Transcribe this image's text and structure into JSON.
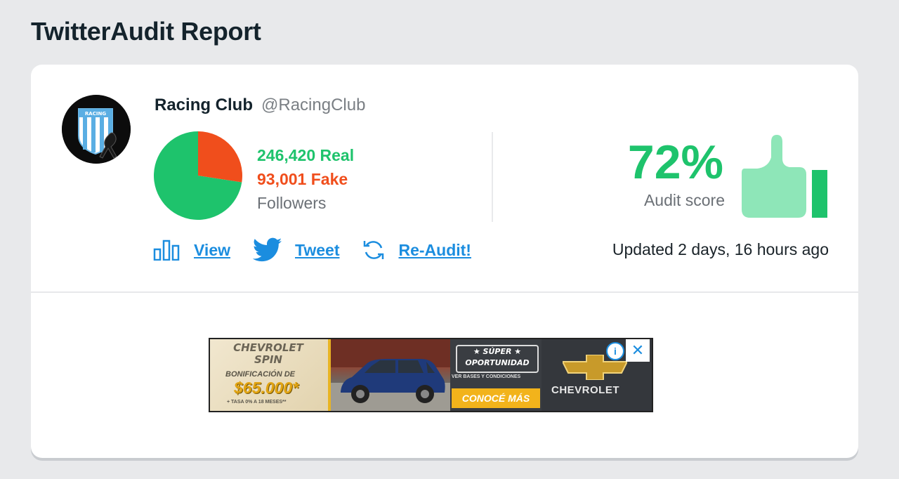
{
  "page": {
    "title": "TwitterAudit Report"
  },
  "account": {
    "name": "Racing Club",
    "handle": "@RacingClub",
    "avatar_text": "RACING"
  },
  "followers": {
    "real_label": "246,420 Real",
    "fake_label": "93,001 Fake",
    "caption": "Followers",
    "real": 246420,
    "fake": 93001
  },
  "score": {
    "value": "72%",
    "label": "Audit score",
    "fraction": 0.72
  },
  "actions": {
    "view": "View",
    "tweet": "Tweet",
    "reaudit": "Re-Audit!"
  },
  "updated": "Updated 2 days, 16 hours ago",
  "ad": {
    "brand_line1": "CHEVROLET",
    "brand_line2": "SPIN",
    "bonus": "BONIFICACIÓN DE",
    "price": "$65.000*",
    "fine_print": "+ TASA 0% A 18 MESES**",
    "badge_line1": "★ SÚPER ★",
    "badge_line2": "OPORTUNIDAD",
    "sub": "VER BASES Y CONDICIONES",
    "cta": "CONOCÉ MÁS",
    "logo_text": "CHEVROLET",
    "info": "i",
    "close": "✕"
  },
  "colors": {
    "real": "#1ec36c",
    "fake": "#f04e1c",
    "link": "#1b8ddf",
    "thumb": "#8ee6b8"
  },
  "icons": [
    "bar-chart-icon",
    "twitter-bird-icon",
    "refresh-icon",
    "thumbs-up-icon",
    "info-icon",
    "close-icon"
  ]
}
